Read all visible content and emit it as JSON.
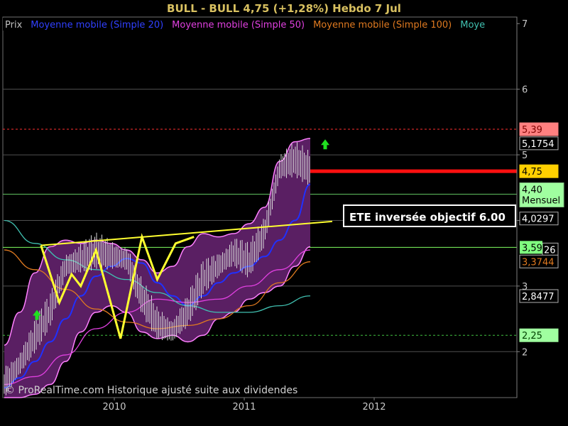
{
  "header": {
    "title": "BULL - BULL      4,75 (+1,28%)     Hebdo  7 Jul"
  },
  "legend": [
    {
      "label": "Prix",
      "color": "#c0c0c0"
    },
    {
      "label": "Moyenne mobile (Simple 20)",
      "color": "#3040ff"
    },
    {
      "label": "Moyenne mobile (Simple 50)",
      "color": "#e040e0"
    },
    {
      "label": "Moyenne mobile (Simple 100)",
      "color": "#e07a20"
    },
    {
      "label": "Moye",
      "color": "#40c0b0"
    }
  ],
  "annotation": "ETE  inversée objectif 6.00",
  "watermark": "© ProRealTime.com Historique ajusté suite aux dividendes",
  "chart_data": {
    "type": "line",
    "x_ticks": [
      "2010",
      "2011",
      "2012"
    ],
    "y_ticks": [
      "2",
      "3",
      "4",
      "5",
      "6",
      "7"
    ],
    "ylim": [
      1.3,
      7.1
    ],
    "grid_levels": [
      2,
      3,
      4,
      5,
      6,
      7
    ],
    "levels": [
      {
        "name": "resistance-dashed",
        "value": 5.39,
        "label": "5,39",
        "style": "dashed",
        "color": "#ff3030"
      },
      {
        "name": "target-bar",
        "value": 4.75,
        "label": "4,75",
        "style": "thick",
        "color": "#ff1010"
      },
      {
        "name": "mensuel",
        "value": 4.4,
        "label": "4,40",
        "sublabel": "Mensuel",
        "style": "solid",
        "color": "#60c060"
      },
      {
        "name": "level-359",
        "value": 3.59,
        "label": "3,59",
        "style": "solid",
        "color": "#80ff60"
      },
      {
        "name": "support-dashed",
        "value": 2.25,
        "label": "2,25",
        "style": "dashed",
        "color": "#40c040"
      }
    ],
    "right_labels": [
      {
        "value": 5.1754,
        "label": "5,1754",
        "bg": "#000",
        "fg": "#ffffff"
      },
      {
        "value": 4.0297,
        "label": "4,0297",
        "bg": "#000",
        "fg": "#ffffff"
      },
      {
        "value": 3.59,
        "label": "26",
        "bg": "#000",
        "fg": "#ffffff"
      },
      {
        "value": 3.3744,
        "label": "3,3744",
        "bg": "#000",
        "fg": "#e07a20"
      },
      {
        "value": 2.8477,
        "label": "2,8477",
        "bg": "#000",
        "fg": "#ffffff"
      }
    ],
    "series": [
      {
        "name": "Moyenne mobile (Simple 20)",
        "color": "#2030ff",
        "t": [
          0.0,
          0.05,
          0.1,
          0.15,
          0.2,
          0.25,
          0.3,
          0.35,
          0.4,
          0.45,
          0.5,
          0.55,
          0.6,
          0.65,
          0.7,
          0.75,
          0.8,
          0.85,
          0.9,
          0.95,
          1.0
        ],
        "values": [
          1.45,
          1.6,
          1.85,
          2.15,
          2.5,
          2.85,
          3.15,
          3.3,
          3.42,
          3.35,
          3.05,
          2.85,
          2.7,
          2.85,
          3.05,
          3.2,
          3.3,
          3.45,
          3.7,
          4.0,
          4.55
        ]
      },
      {
        "name": "Moyenne mobile (Simple 50)",
        "color": "#e040e0",
        "t": [
          0.0,
          0.1,
          0.2,
          0.3,
          0.4,
          0.5,
          0.6,
          0.7,
          0.8,
          0.9,
          1.0
        ],
        "values": [
          1.5,
          1.62,
          1.95,
          2.35,
          2.6,
          2.8,
          2.75,
          2.8,
          3.0,
          3.25,
          3.55
        ]
      },
      {
        "name": "Moyenne mobile (Simple 100)",
        "color": "#e07a20",
        "t": [
          0.0,
          0.1,
          0.2,
          0.3,
          0.4,
          0.5,
          0.6,
          0.7,
          0.8,
          0.9,
          1.0
        ],
        "values": [
          3.55,
          3.25,
          2.95,
          2.65,
          2.45,
          2.35,
          2.4,
          2.5,
          2.7,
          3.05,
          3.37
        ]
      },
      {
        "name": "Moye",
        "color": "#40c0b0",
        "t": [
          0.0,
          0.1,
          0.2,
          0.3,
          0.4,
          0.5,
          0.6,
          0.7,
          0.8,
          0.9,
          1.0
        ],
        "values": [
          4.0,
          3.65,
          3.4,
          3.25,
          3.1,
          2.9,
          2.7,
          2.6,
          2.6,
          2.7,
          2.85
        ]
      }
    ],
    "bollinger_upper": [
      2.1,
      2.6,
      3.2,
      3.6,
      3.7,
      3.65,
      3.7,
      3.65,
      3.55,
      3.4,
      3.2,
      3.3,
      3.6,
      3.8,
      3.75,
      3.8,
      3.95,
      4.2,
      4.9,
      5.2,
      5.25
    ],
    "bollinger_lower": [
      1.3,
      1.3,
      1.35,
      1.5,
      1.85,
      2.3,
      2.6,
      2.7,
      2.6,
      2.3,
      2.2,
      2.25,
      2.15,
      2.25,
      2.5,
      2.6,
      2.8,
      2.9,
      3.0,
      3.3,
      3.6
    ],
    "price": [
      1.5,
      1.8,
      2.2,
      2.6,
      3.3,
      3.4,
      3.5,
      3.45,
      3.4,
      2.8,
      2.4,
      2.3,
      2.6,
      3.1,
      3.3,
      3.5,
      3.35,
      3.8,
      4.8,
      4.9,
      4.75
    ],
    "pattern_points": [
      [
        0.12,
        3.62
      ],
      [
        0.18,
        2.75
      ],
      [
        0.22,
        3.18
      ],
      [
        0.25,
        3.0
      ],
      [
        0.3,
        3.55
      ],
      [
        0.38,
        2.2
      ],
      [
        0.45,
        3.75
      ],
      [
        0.5,
        3.1
      ],
      [
        0.56,
        3.65
      ],
      [
        0.62,
        3.75
      ]
    ],
    "neckline": [
      [
        0.12,
        3.62
      ],
      [
        0.69,
        4.05
      ]
    ],
    "arrows": [
      {
        "t": 0.07,
        "value": 2.55
      },
      {
        "t": 0.72,
        "value": 5.15
      }
    ]
  }
}
